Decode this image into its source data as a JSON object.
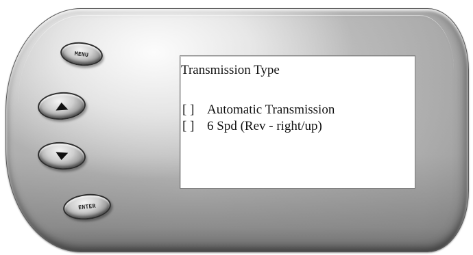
{
  "buttons": {
    "menu_label": "MENU",
    "up_icon": "up-arrow",
    "down_icon": "down-arrow",
    "enter_label": "ENTER"
  },
  "screen": {
    "title": "Transmission Type",
    "options": [
      {
        "checkbox": "[ ]",
        "label": "Automatic Transmission"
      },
      {
        "checkbox": "[ ]",
        "label": "6 Spd (Rev - right/up)"
      }
    ]
  },
  "colors": {
    "screen_bg": "#ffffff",
    "text": "#111111",
    "device_body": "#c8c8c8"
  }
}
